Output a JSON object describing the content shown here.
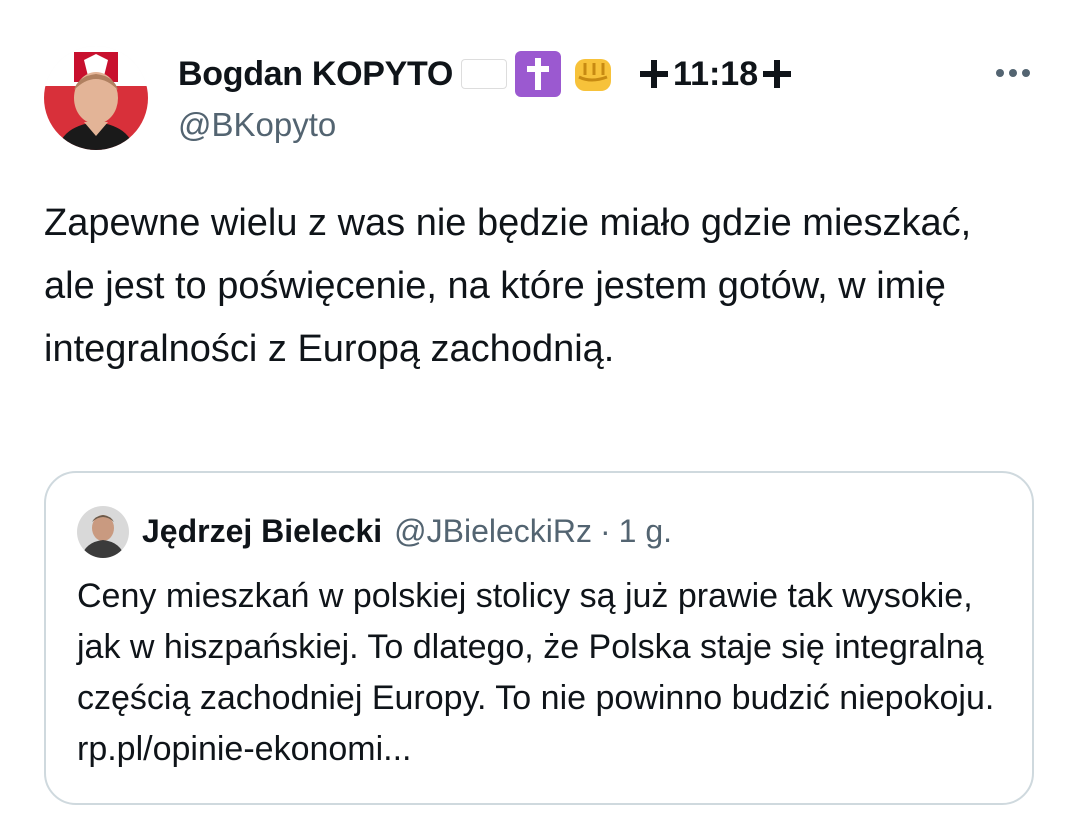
{
  "tweet": {
    "author": {
      "name": "Bogdan KOPYTO",
      "emojis": [
        "poland-flag",
        "latin-cross",
        "raised-fist"
      ],
      "name_suffix": "11:18",
      "handle": "@BKopyto"
    },
    "text": "Zapewne wielu z was nie będzie miało gdzie mieszkać, ale jest to poświęcenie, na które jestem gotów, w imię integralności z Europą zachodnią.",
    "more_icon": "ellipsis-horizontal-icon"
  },
  "quote": {
    "author": {
      "name": "Jędrzej Bielecki",
      "handle": "@JBieleckiRz",
      "separator": "·",
      "time": "1 g."
    },
    "text": "Ceny mieszkań w polskiej stolicy są już prawie tak wysokie, jak w hiszpańskiej. To dlatego, że Polska staje się integralną częścią zachodniej Europy. To nie powinno budzić niepokoju. rp.pl/opinie-ekonomi..."
  },
  "colors": {
    "text_primary": "#0f1419",
    "text_secondary": "#536471",
    "card_border": "#cfd9de",
    "cross_box": "#9b59d0",
    "flag_red": "#dc143c"
  }
}
